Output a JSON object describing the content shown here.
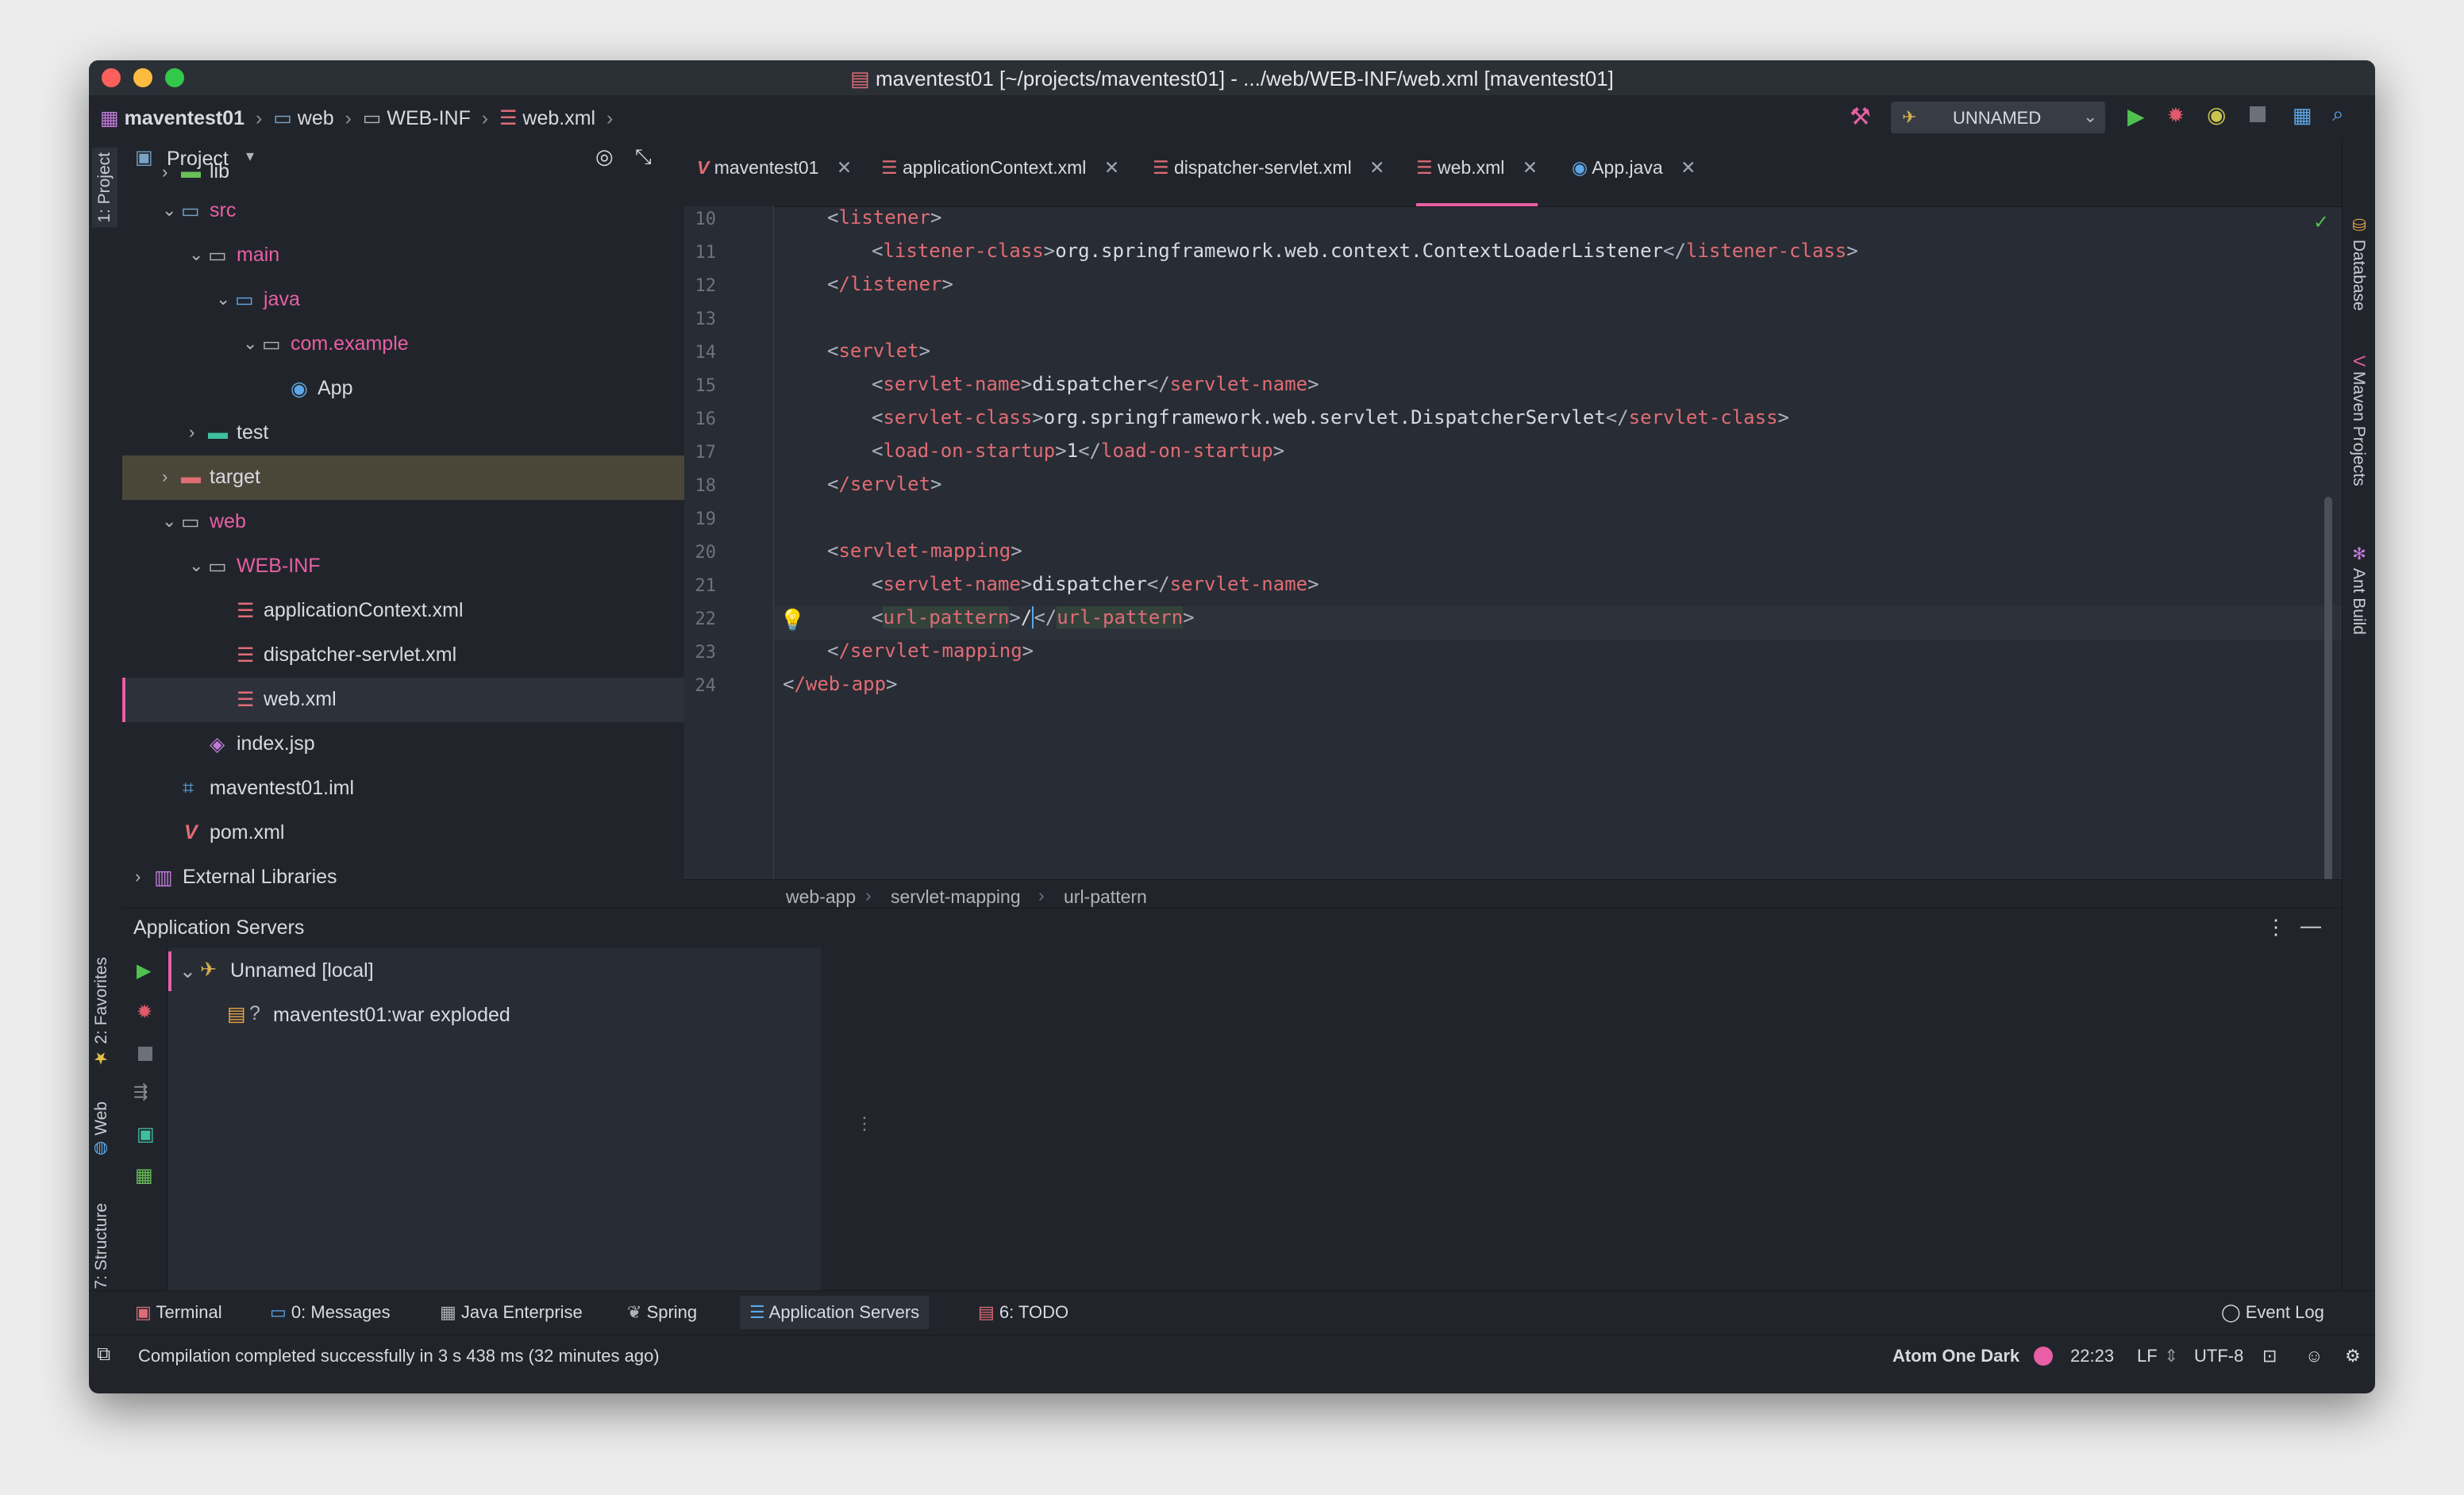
{
  "window": {
    "title": "maventest01 [~/projects/maventest01] - .../web/WEB-INF/web.xml [maventest01]"
  },
  "navbar": {
    "crumbs": [
      "maventest01",
      "web",
      "WEB-INF",
      "web.xml"
    ],
    "run_config": "UNNAMED"
  },
  "left_tool_tabs": {
    "project": "1: Project",
    "favorites": "2: Favorites",
    "web": "Web",
    "structure": "7: Structure"
  },
  "right_tool_tabs": {
    "database": "Database",
    "maven": "Maven Projects",
    "ant": "Ant Build"
  },
  "project": {
    "header": "Project",
    "tree": [
      {
        "label": "lib",
        "kind": "folder-lib"
      },
      {
        "label": "src",
        "kind": "folder-src"
      },
      {
        "label": "main",
        "kind": "folder"
      },
      {
        "label": "java",
        "kind": "folder-java"
      },
      {
        "label": "com.example",
        "kind": "package"
      },
      {
        "label": "App",
        "kind": "class"
      },
      {
        "label": "test",
        "kind": "folder-test"
      },
      {
        "label": "target",
        "kind": "folder-target"
      },
      {
        "label": "web",
        "kind": "folder"
      },
      {
        "label": "WEB-INF",
        "kind": "folder"
      },
      {
        "label": "applicationContext.xml",
        "kind": "xml"
      },
      {
        "label": "dispatcher-servlet.xml",
        "kind": "xml"
      },
      {
        "label": "web.xml",
        "kind": "xml"
      },
      {
        "label": "index.jsp",
        "kind": "jsp"
      },
      {
        "label": "maventest01.iml",
        "kind": "iml"
      },
      {
        "label": "pom.xml",
        "kind": "maven"
      },
      {
        "label": "External Libraries",
        "kind": "libraries"
      }
    ]
  },
  "editor": {
    "tabs": [
      {
        "label": "maventest01",
        "kind": "maven"
      },
      {
        "label": "applicationContext.xml",
        "kind": "xml"
      },
      {
        "label": "dispatcher-servlet.xml",
        "kind": "xml"
      },
      {
        "label": "web.xml",
        "kind": "xml"
      },
      {
        "label": "App.java",
        "kind": "class"
      }
    ],
    "line_numbers": [
      "10",
      "11",
      "12",
      "13",
      "14",
      "15",
      "16",
      "17",
      "18",
      "19",
      "20",
      "21",
      "22",
      "23",
      "24"
    ],
    "breadcrumb": [
      "web-app",
      "servlet-mapping",
      "url-pattern"
    ],
    "code": {
      "l10": "listener",
      "l11_tag": "listener-class",
      "l11_text": "org.springframework.web.context.ContextLoaderListener",
      "l12": "/listener",
      "l14": "servlet",
      "l15_tag": "servlet-name",
      "l15_text": "dispatcher",
      "l16_tag": "servlet-class",
      "l16_text": "org.springframework.web.servlet.DispatcherServlet",
      "l17_tag": "load-on-startup",
      "l17_text": "1",
      "l18": "/servlet",
      "l20": "servlet-mapping",
      "l21_tag": "servlet-name",
      "l21_text": "dispatcher",
      "l22_tag": "url-pattern",
      "l22_text": "/",
      "l23": "/servlet-mapping",
      "l24": "/web-app"
    }
  },
  "app_servers": {
    "title": "Application Servers",
    "server": "Unnamed [local]",
    "artifact": "maventest01:war exploded"
  },
  "bottom_tabs": [
    {
      "label": "Terminal"
    },
    {
      "label": "0: Messages"
    },
    {
      "label": "Java Enterprise"
    },
    {
      "label": "Spring"
    },
    {
      "label": "Application Servers"
    },
    {
      "label": "6: TODO"
    }
  ],
  "event_log": "Event Log",
  "status": {
    "message": "Compilation completed successfully in 3 s 438 ms (32 minutes ago)",
    "theme": "Atom One Dark",
    "position": "22:23",
    "line_sep": "LF",
    "encoding": "UTF-8"
  },
  "colors": {
    "accent": "#e85fa5",
    "tag": "#e06c75",
    "bg_editor": "#282c34",
    "bg_panel": "#21252b"
  }
}
